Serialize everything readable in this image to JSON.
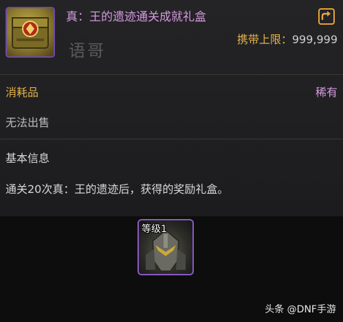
{
  "item": {
    "title": "真：王的遗迹通关成就礼盒",
    "icon": "treasure-chest-icon",
    "carry_limit_label": "携带上限：",
    "carry_limit_value": "999,999",
    "category": "消耗品",
    "rarity": "稀有",
    "trade_status": "无法出售",
    "info_header": "基本信息",
    "description": "通关20次真：王的遗迹后，获得的奖励礼盒。"
  },
  "watermark_text": "语哥",
  "requirement": {
    "label": "等级1",
    "icon": "armored-knight-icon"
  },
  "source_credit": "头条 @DNF手游",
  "colors": {
    "rarity_purple": "#d59ae0",
    "label_gold": "#e3b24a",
    "border_purple": "#8a5ac6",
    "export_orange": "#e8a33a"
  }
}
